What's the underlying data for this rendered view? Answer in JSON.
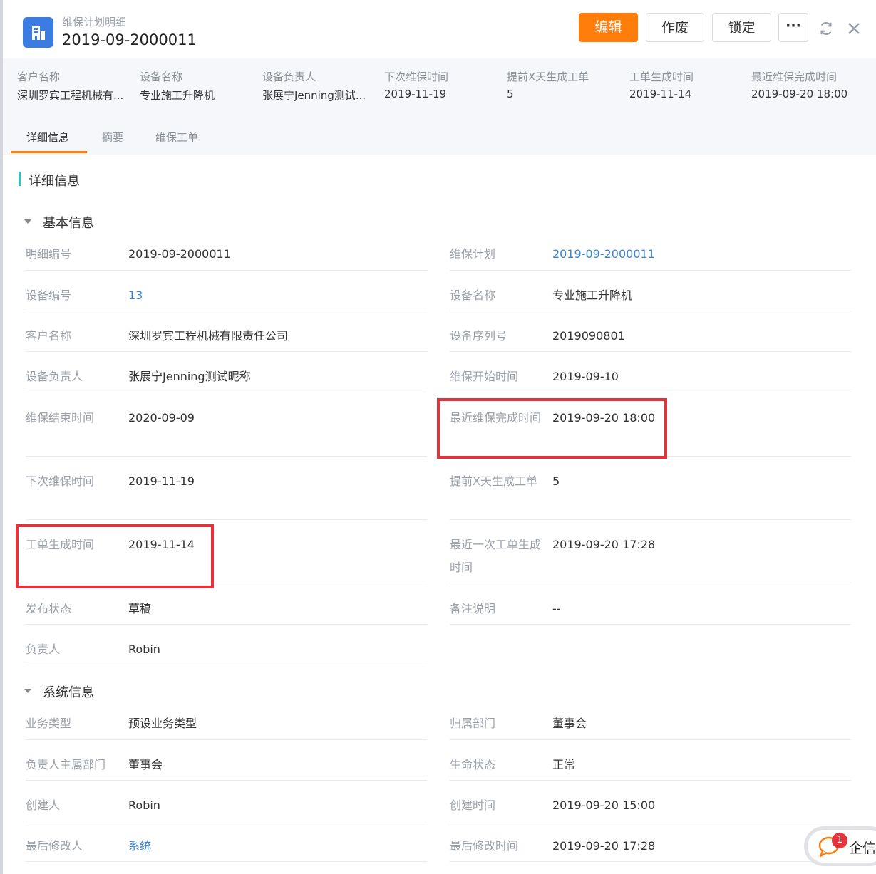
{
  "header": {
    "subtitle": "维保计划明细",
    "title": "2019-09-2000011",
    "buttons": {
      "edit": "编辑",
      "void": "作废",
      "lock": "锁定",
      "more": "···"
    }
  },
  "summary": [
    {
      "label": "客户名称",
      "value": "深圳罗宾工程机械有..."
    },
    {
      "label": "设备名称",
      "value": "专业施工升降机"
    },
    {
      "label": "设备负责人",
      "value": "张展宁Jenning测试..."
    },
    {
      "label": "下次维保时间",
      "value": "2019-11-19"
    },
    {
      "label": "提前X天生成工单",
      "value": "5"
    },
    {
      "label": "工单生成时间",
      "value": "2019-11-14"
    },
    {
      "label": "最近维保完成时间",
      "value": "2019-09-20 18:00"
    }
  ],
  "tabs": [
    "详细信息",
    "摘要",
    "维保工单"
  ],
  "section_title": "详细信息",
  "basic": {
    "title": "基本信息",
    "fields": [
      {
        "label": "明细编号",
        "value": "2019-09-2000011"
      },
      {
        "label": "维保计划",
        "value": "2019-09-2000011"
      },
      {
        "label": "设备编号",
        "value": "13"
      },
      {
        "label": "设备名称",
        "value": "专业施工升降机"
      },
      {
        "label": "客户名称",
        "value": "深圳罗宾工程机械有限责任公司"
      },
      {
        "label": "设备序列号",
        "value": "2019090801"
      },
      {
        "label": "设备负责人",
        "value": "张展宁Jenning测试昵称"
      },
      {
        "label": "维保开始时间",
        "value": "2019-09-10"
      },
      {
        "label": "维保结束时间",
        "value": "2020-09-09"
      },
      {
        "label": "最近维保完成时间",
        "value": "2019-09-20 18:00"
      },
      {
        "label": "下次维保时间",
        "value": "2019-11-19"
      },
      {
        "label": "提前X天生成工单",
        "value": "5"
      },
      {
        "label": "工单生成时间",
        "value": "2019-11-14"
      },
      {
        "label": "最近一次工单生成时间",
        "value": "2019-09-20 17:28"
      },
      {
        "label": "发布状态",
        "value": "草稿"
      },
      {
        "label": "备注说明",
        "value": "--"
      },
      {
        "label": "负责人",
        "value": "Robin"
      }
    ]
  },
  "system": {
    "title": "系统信息",
    "fields": [
      {
        "label": "业务类型",
        "value": "预设业务类型"
      },
      {
        "label": "归属部门",
        "value": "董事会"
      },
      {
        "label": "负责人主属部门",
        "value": "董事会"
      },
      {
        "label": "生命状态",
        "value": "正常"
      },
      {
        "label": "创建人",
        "value": "Robin"
      },
      {
        "label": "创建时间",
        "value": "2019-09-20 15:00"
      },
      {
        "label": "最后修改人",
        "value": "系统"
      },
      {
        "label": "最后修改时间",
        "value": "2019-09-20 17:28"
      }
    ]
  },
  "chat": {
    "badge": "1",
    "label": "企信"
  },
  "colors": {
    "accent": "#ff7d0a",
    "link": "#3a86d0",
    "highlight": "#e5333b",
    "section_bar": "#2fc3c8"
  }
}
